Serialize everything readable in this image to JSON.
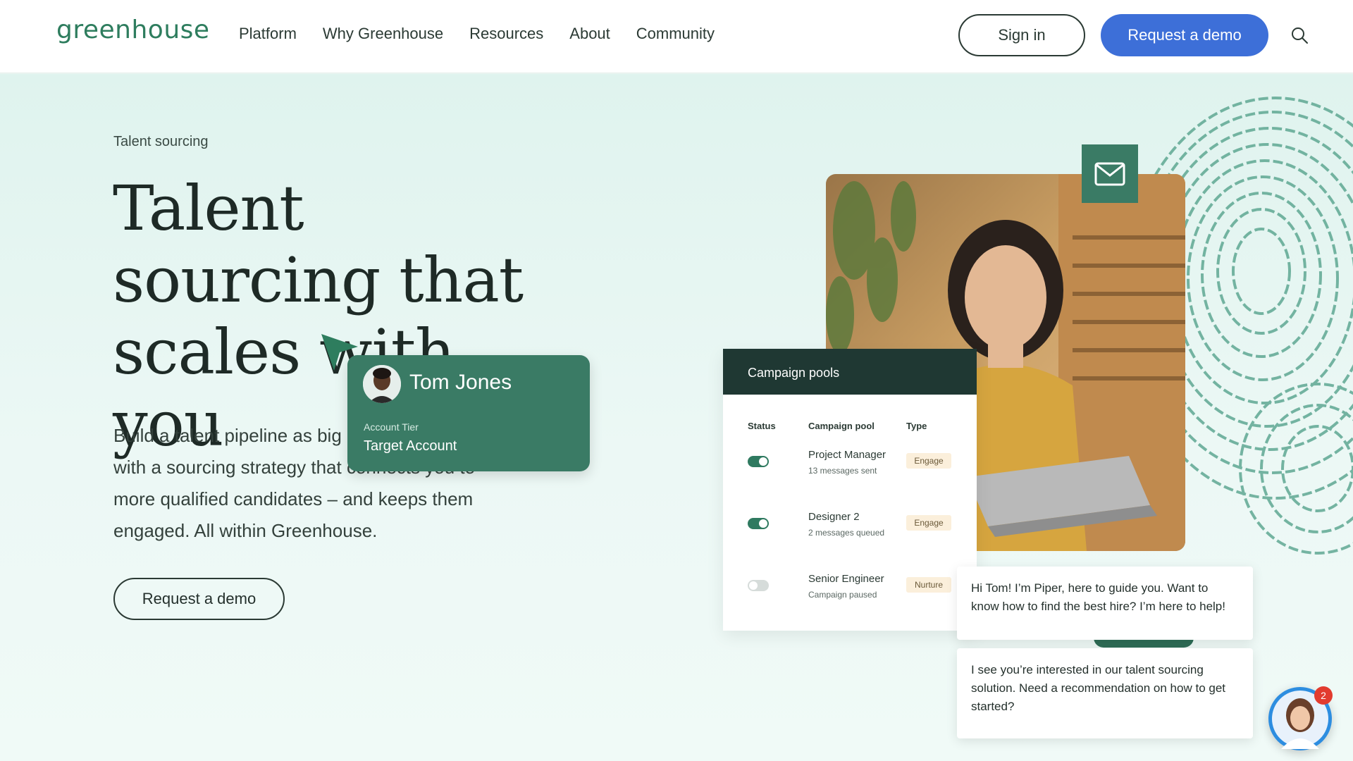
{
  "nav": {
    "logo": "greenhouse",
    "links": [
      "Platform",
      "Why Greenhouse",
      "Resources",
      "About",
      "Community"
    ],
    "signin_label": "Sign in",
    "demo_label": "Request a demo",
    "search_icon": "search-icon"
  },
  "hero": {
    "eyebrow": "Talent sourcing",
    "headline": "Talent sourcing that scales with you",
    "body": "Build a talent pipeline as big as your ambitions with a sourcing strategy that connects you to more qualified candidates – and keeps them engaged. All within Greenhouse.",
    "cta_label": "Request a demo"
  },
  "contact_card": {
    "name": "Tom Jones",
    "tier_label": "Account Tier",
    "tier_value": "Target Account"
  },
  "campaign": {
    "title": "Campaign pools",
    "columns": [
      "Status",
      "Campaign pool",
      "Type"
    ],
    "rows": [
      {
        "status": "on",
        "name": "Project Manager",
        "sub": "13 messages sent",
        "type": "Engage"
      },
      {
        "status": "on",
        "name": "Designer 2",
        "sub": "2 messages queued",
        "type": "Engage"
      },
      {
        "status": "off",
        "name": "Senior Engineer",
        "sub": "Campaign paused",
        "type": "Nurture"
      }
    ]
  },
  "chat": {
    "message_1": "Hi Tom! I’m Piper, here to guide you. Want to know how to find the best hire? I’m here to help!",
    "message_2": "I see you’re interested in our talent sourcing solution. Need a recommendation on how to get started?",
    "unread_count": "2"
  },
  "colors": {
    "brand_green": "#3a7b65",
    "accent_blue": "#3d6fd8",
    "hero_bg": "#ebf7f3",
    "dark_header": "#1f3833"
  }
}
